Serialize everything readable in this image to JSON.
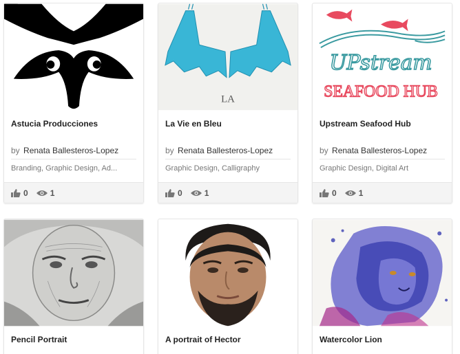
{
  "projects": [
    {
      "title": "Astucia Producciones",
      "owner_prefix": "by",
      "owner": "Renata Ballesteros-Lopez",
      "fields": [
        "Branding",
        "Graphic Design",
        "Ad..."
      ],
      "appreciations": "0",
      "views": "1",
      "thumb_icon": "raccoon-mask-logo"
    },
    {
      "title": "La Vie en Bleu",
      "owner_prefix": "by",
      "owner": "Renata Ballesteros-Lopez",
      "fields": [
        "Graphic Design",
        "Calligraphy"
      ],
      "appreciations": "0",
      "views": "1",
      "thumb_text": "LA",
      "thumb_icon": "blue-bird-feet-illustration"
    },
    {
      "title": "Upstream Seafood Hub",
      "owner_prefix": "by",
      "owner": "Renata Ballesteros-Lopez",
      "fields": [
        "Graphic Design",
        "Digital Art"
      ],
      "appreciations": "0",
      "views": "1",
      "thumb_logo_line1": "UPstream",
      "thumb_logo_line2": "SEAFOOD HUB",
      "thumb_icon": "salmon-logo"
    },
    {
      "title": "Pencil Portrait",
      "thumb_icon": "pencil-portrait-elder-woman"
    },
    {
      "title": "A portrait of Hector",
      "thumb_icon": "digital-portrait-man"
    },
    {
      "title": "Watercolor Lion",
      "thumb_icon": "watercolor-lion"
    }
  ],
  "colors": {
    "accent_blue": "#29b8d8",
    "salmon_red": "#e84a5f",
    "logo_teal": "#3a9aa0",
    "watercolor_blue": "#3a3fb0"
  }
}
